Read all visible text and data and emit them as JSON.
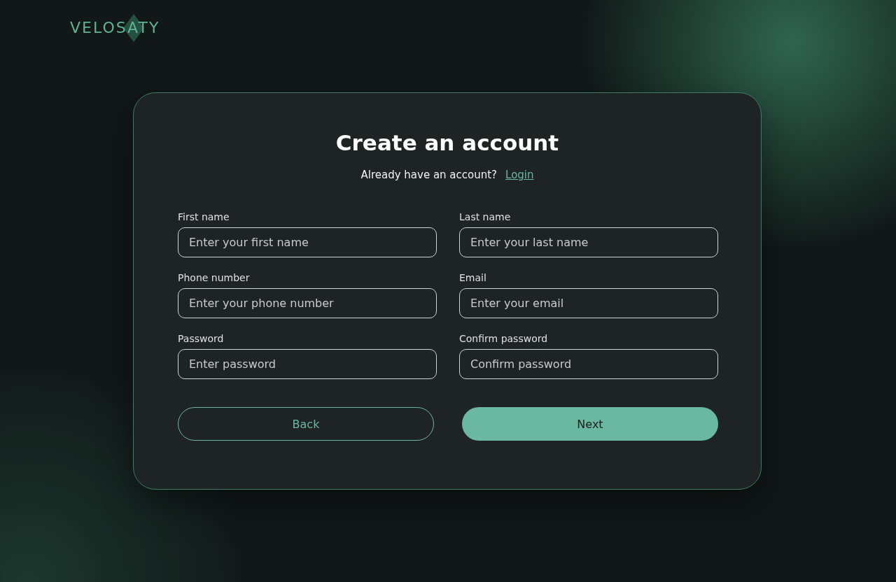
{
  "logo": {
    "text": "VELOSATY"
  },
  "form": {
    "title": "Create an account",
    "prompt": "Already have an account?",
    "login_link": "Login",
    "fields": [
      {
        "label": "First name",
        "placeholder": "Enter your first name"
      },
      {
        "label": "Last name",
        "placeholder": "Enter your last name"
      },
      {
        "label": "Phone number",
        "placeholder": "Enter your phone number"
      },
      {
        "label": "Email",
        "placeholder": "Enter your email"
      },
      {
        "label": "Password",
        "placeholder": "Enter password"
      },
      {
        "label": "Confirm password",
        "placeholder": "Confirm password"
      }
    ],
    "buttons": [
      {
        "label": "Back",
        "kind": "secondary"
      },
      {
        "label": "Next",
        "kind": "primary"
      }
    ]
  }
}
